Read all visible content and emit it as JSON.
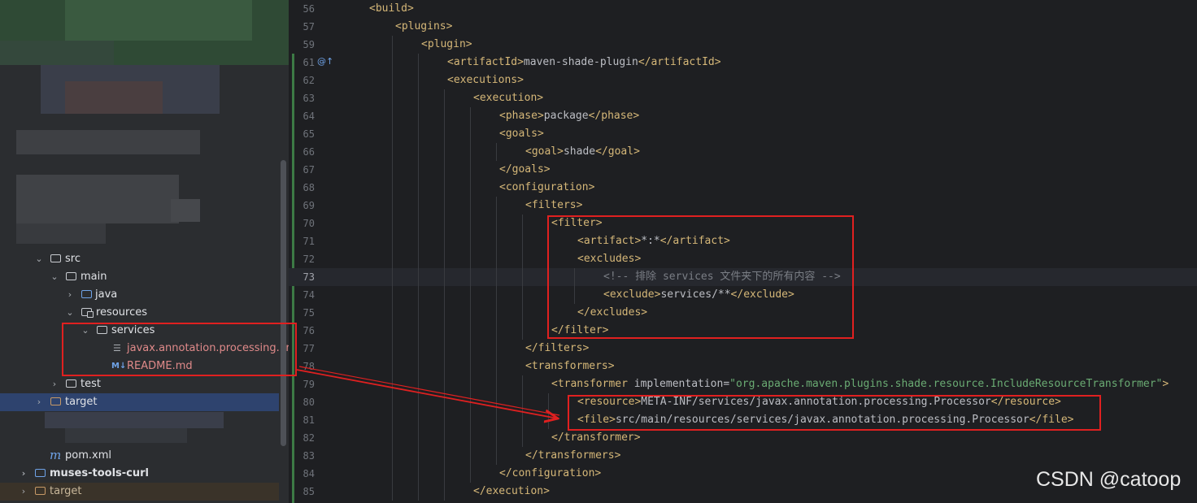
{
  "project_tree": {
    "items": [
      {
        "label": "src",
        "icon": "folder-icon",
        "expanded": true
      },
      {
        "label": "main",
        "icon": "folder-icon",
        "expanded": true
      },
      {
        "label": "java",
        "icon": "source-folder-icon",
        "expanded": false
      },
      {
        "label": "resources",
        "icon": "resources-folder-icon",
        "expanded": true
      },
      {
        "label": "services",
        "icon": "folder-icon",
        "expanded": true
      },
      {
        "label": "javax.annotation.processing.Proce",
        "icon": "text-file-icon"
      },
      {
        "label": "README.md",
        "icon": "markdown-file-icon",
        "icon_text": "M↓"
      },
      {
        "label": "test",
        "icon": "folder-icon",
        "expanded": false
      },
      {
        "label": "target",
        "icon": "excluded-folder-icon",
        "expanded": false,
        "selected": true
      },
      {
        "label": "pom.xml",
        "icon": "maven-icon",
        "icon_text": "m"
      },
      {
        "label": "muses-tools-curl",
        "icon": "module-folder-icon",
        "expanded": false
      },
      {
        "label": "target",
        "icon": "excluded-folder-icon",
        "expanded": false
      }
    ]
  },
  "editor": {
    "current_line": "73",
    "lines": [
      {
        "n": "56"
      },
      {
        "n": "57"
      },
      {
        "n": "59"
      },
      {
        "n": "61"
      },
      {
        "n": "62"
      },
      {
        "n": "63"
      },
      {
        "n": "64"
      },
      {
        "n": "65"
      },
      {
        "n": "66"
      },
      {
        "n": "67"
      },
      {
        "n": "68"
      },
      {
        "n": "69"
      },
      {
        "n": "70"
      },
      {
        "n": "71"
      },
      {
        "n": "72"
      },
      {
        "n": "73"
      },
      {
        "n": "74"
      },
      {
        "n": "75"
      },
      {
        "n": "76"
      },
      {
        "n": "77"
      },
      {
        "n": "78"
      },
      {
        "n": "79"
      },
      {
        "n": "80"
      },
      {
        "n": "81"
      },
      {
        "n": "82"
      },
      {
        "n": "83"
      },
      {
        "n": "84"
      },
      {
        "n": "85"
      }
    ],
    "code": {
      "l56": [
        "<build>"
      ],
      "l57": [
        "<plugins>"
      ],
      "l59": [
        "<plugin>"
      ],
      "l61": [
        "<artifactId>",
        "maven-shade-plugin",
        "</artifactId>"
      ],
      "l62": [
        "<executions>"
      ],
      "l63": [
        "<execution>"
      ],
      "l64": [
        "<phase>",
        "package",
        "</phase>"
      ],
      "l65": [
        "<goals>"
      ],
      "l66": [
        "<goal>",
        "shade",
        "</goal>"
      ],
      "l67": [
        "</goals>"
      ],
      "l68": [
        "<configuration>"
      ],
      "l69": [
        "<filters>"
      ],
      "l70": [
        "<filter>"
      ],
      "l71": [
        "<artifact>",
        "*:*",
        "</artifact>"
      ],
      "l72": [
        "<excludes>"
      ],
      "l73": [
        "<!-- 排除 services 文件夹下的所有内容 -->"
      ],
      "l74": [
        "<exclude>",
        "services/**",
        "</exclude>"
      ],
      "l75": [
        "</excludes>"
      ],
      "l76": [
        "</filter>"
      ],
      "l77": [
        "</filters>"
      ],
      "l78": [
        "<transformers>"
      ],
      "l79": [
        "<transformer ",
        "implementation",
        "=",
        "\"org.apache.maven.plugins.shade.resource.IncludeResourceTransformer\"",
        ">"
      ],
      "l80": [
        "<resource>",
        "META-INF/services/javax.annotation.processing.Processor",
        "</resource>"
      ],
      "l81": [
        "<file>",
        "src/main/resources/services/javax.annotation.processing.Processor",
        "</file>"
      ],
      "l82": [
        "</transformer>"
      ],
      "l83": [
        "</transformers>"
      ],
      "l84": [
        "</configuration>"
      ],
      "l85": [
        "</execution>"
      ]
    }
  },
  "colors": {
    "tag": "#d5b778",
    "text": "#bcbec4",
    "string": "#6aab73",
    "comment": "#7a7e85",
    "highlight": "#e02020"
  },
  "watermark": "CSDN @catoop"
}
